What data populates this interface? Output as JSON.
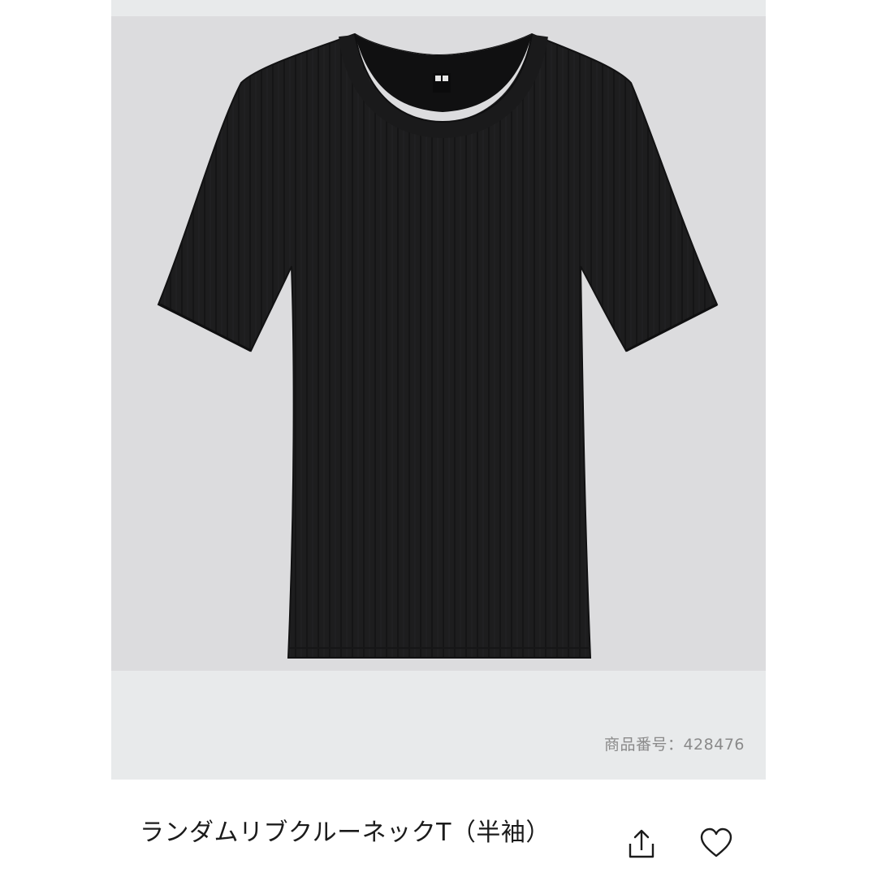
{
  "product": {
    "image_alt": "ランダムリブクルーネックT（半袖）",
    "code_label": "商品番号：428476",
    "title": "ランダムリブクルーネックT（半袖）"
  },
  "actions": {
    "share_icon": "share-icon",
    "favorite_icon": "heart-icon"
  },
  "colors": {
    "gallery_bg": "#e8eaeb",
    "photo_bg": "#dcdcde",
    "garment": "#1c1c1c",
    "text": "#1b1b1b",
    "muted_text": "#8a8a8a"
  }
}
